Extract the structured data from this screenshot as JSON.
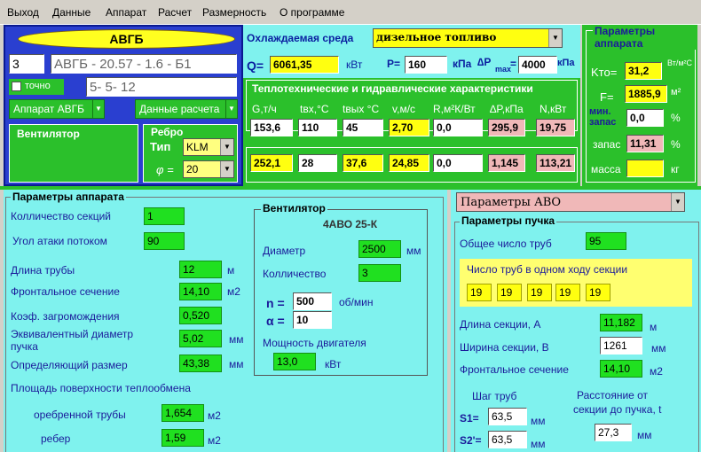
{
  "menu": [
    "Выход",
    "Данные",
    "Аппарат",
    "Расчет",
    "Размерность",
    "О программе"
  ],
  "top": {
    "title": "АВГБ",
    "num": "3",
    "model": "АВГБ - 20.57 - 1.6 - Б1",
    "exact": "точно",
    "code": "5- 5- 12",
    "apparatus_combo": "Аппарат АВГБ",
    "calc_combo": "Данные расчета",
    "fan_group": "Вентилятор",
    "rib_group": "Ребро",
    "rib_type_label": "Тип",
    "rib_type": "KLM",
    "phi_label": "φ =",
    "phi": "20"
  },
  "medium": {
    "label": "Охлаждаемая среда",
    "value": "дизельное топливо",
    "q_label": "Q=",
    "q": "6061,35",
    "q_unit": "кВт",
    "p_label": "P=",
    "p": "160",
    "p_unit": "кПа",
    "dp_label": "∆P",
    "dp_sub": "max",
    "dp_eq": "=",
    "dp": "4000",
    "dp_unit": "кПа"
  },
  "thermo": {
    "title": "Теплотехнические и гидравлические характеристики",
    "h1": "G,т/ч",
    "h2": "tвх,°C",
    "h3": "tвых °C",
    "h4": "v,м/с",
    "h5": "R,м²К/Вт",
    "h6": "∆P,кПа",
    "h7": "N,кВт",
    "row1": [
      "153,6",
      "110",
      "45",
      "2,70",
      "0,0",
      "295,9",
      "19,75"
    ],
    "row2": [
      "252,1",
      "28",
      "37,6",
      "24,85",
      "0,0",
      "1,145",
      "113,21"
    ]
  },
  "params": {
    "title": "Параметры аппарата",
    "k_label": "Kто=",
    "k": "31,2",
    "k_unit": "Вт/м²С",
    "f_label": "F=",
    "f": "1885,9",
    "f_unit": "м²",
    "minzap_label": "мин. запас",
    "minzap": "0,0",
    "minzap_unit": "%",
    "zap_label": "запас",
    "zap": "11,31",
    "zap_unit": "%",
    "mass_label": "масса",
    "mass": "",
    "mass_unit": "кг"
  },
  "app": {
    "title": "Параметры аппарата",
    "sections_label": "Колличество секций",
    "sections": "1",
    "angle_label": "Угол атаки потоком",
    "angle": "90",
    "tube_label": "Длина трубы",
    "tube": "12",
    "tube_unit": "м",
    "front_label": "Фронтальное сечение",
    "front": "14,10",
    "front_unit": "м2",
    "clutter_label": "Коэф. загромождения",
    "clutter": "0,520",
    "eqd_label1": "Эквивалентный диаметр",
    "eqd_label2": "пучка",
    "eqd": "5,02",
    "eqd_unit": "мм",
    "defsize_label": "Определяющий размер",
    "defsize": "43,38",
    "defsize_unit": "мм",
    "surface_label": "Площадь поверхности теплообмена",
    "ribbed_label": "оребренной трубы",
    "ribbed": "1,654",
    "ribbed_unit": "м2",
    "ribs_label": "ребер",
    "ribs": "1,59",
    "ribs_unit": "м2"
  },
  "fan": {
    "title": "Вентилятор",
    "model": "4АВО 25-К",
    "diam_label": "Диаметр",
    "diam": "2500",
    "diam_unit": "мм",
    "qty_label": "Колличество",
    "qty": "3",
    "n_label": "n =",
    "n": "500",
    "n_unit": "об/мин",
    "a_label": "α =",
    "a": "10",
    "power_label": "Мощность двигателя",
    "power": "13,0",
    "power_unit": "кВт"
  },
  "avo": {
    "combo": "Параметры АВО",
    "bundle_title": "Параметры пучка",
    "total_label": "Общее число труб",
    "total": "95",
    "perpass_label": "Число труб в одном ходу секции",
    "perpass": [
      "19",
      "19",
      "19",
      "19",
      "19"
    ],
    "len_label": "Длина секции, А",
    "len": "11,182",
    "len_unit": "м",
    "wid_label": "Ширина секции, В",
    "wid": "1261",
    "wid_unit": "мм",
    "front_label": "Фронтальное сечение",
    "front": "14,10",
    "front_unit": "м2",
    "pitch_label": "Шаг труб",
    "s1_label": "S1=",
    "s1": "63,5",
    "s1_unit": "мм",
    "s2_label": "S2'=",
    "s2": "63,5",
    "s2_unit": "мм",
    "dist_label1": "Расстояние от",
    "dist_label2": "секции до пучка, t",
    "dist": "27,3",
    "dist_unit": "мм"
  }
}
